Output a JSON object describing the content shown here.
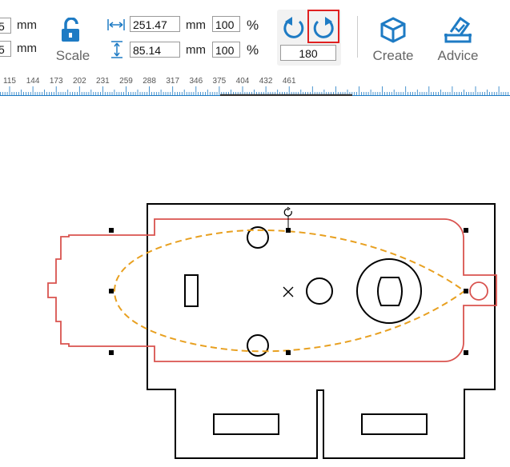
{
  "toolbar": {
    "size_unit_1": "mm",
    "size_unit_2": "mm",
    "size_val_1": "5",
    "size_val_2": "5",
    "scale_label": "Scale",
    "width_value": "251.47",
    "height_value": "85.14",
    "width_unit": "mm",
    "height_unit": "mm",
    "width_percent": "100",
    "height_percent": "100",
    "percent_sign_1": "%",
    "percent_sign_2": "%",
    "rotation_value": "180",
    "create_label": "Create",
    "advice_label": "Advice",
    "accent_color": "#1e7bc4",
    "highlight_color": "#e02020"
  },
  "ruler": {
    "labels": [
      "115",
      "144",
      "173",
      "202",
      "231",
      "259",
      "288",
      "317",
      "346",
      "375",
      "404",
      "432",
      "461"
    ]
  },
  "canvas": {
    "cut_color": "#000000",
    "engrave_color": "#d9534f",
    "selection_color": "#e8a020",
    "icons": [
      "rotate-handle-icon",
      "center-cross-icon"
    ]
  }
}
